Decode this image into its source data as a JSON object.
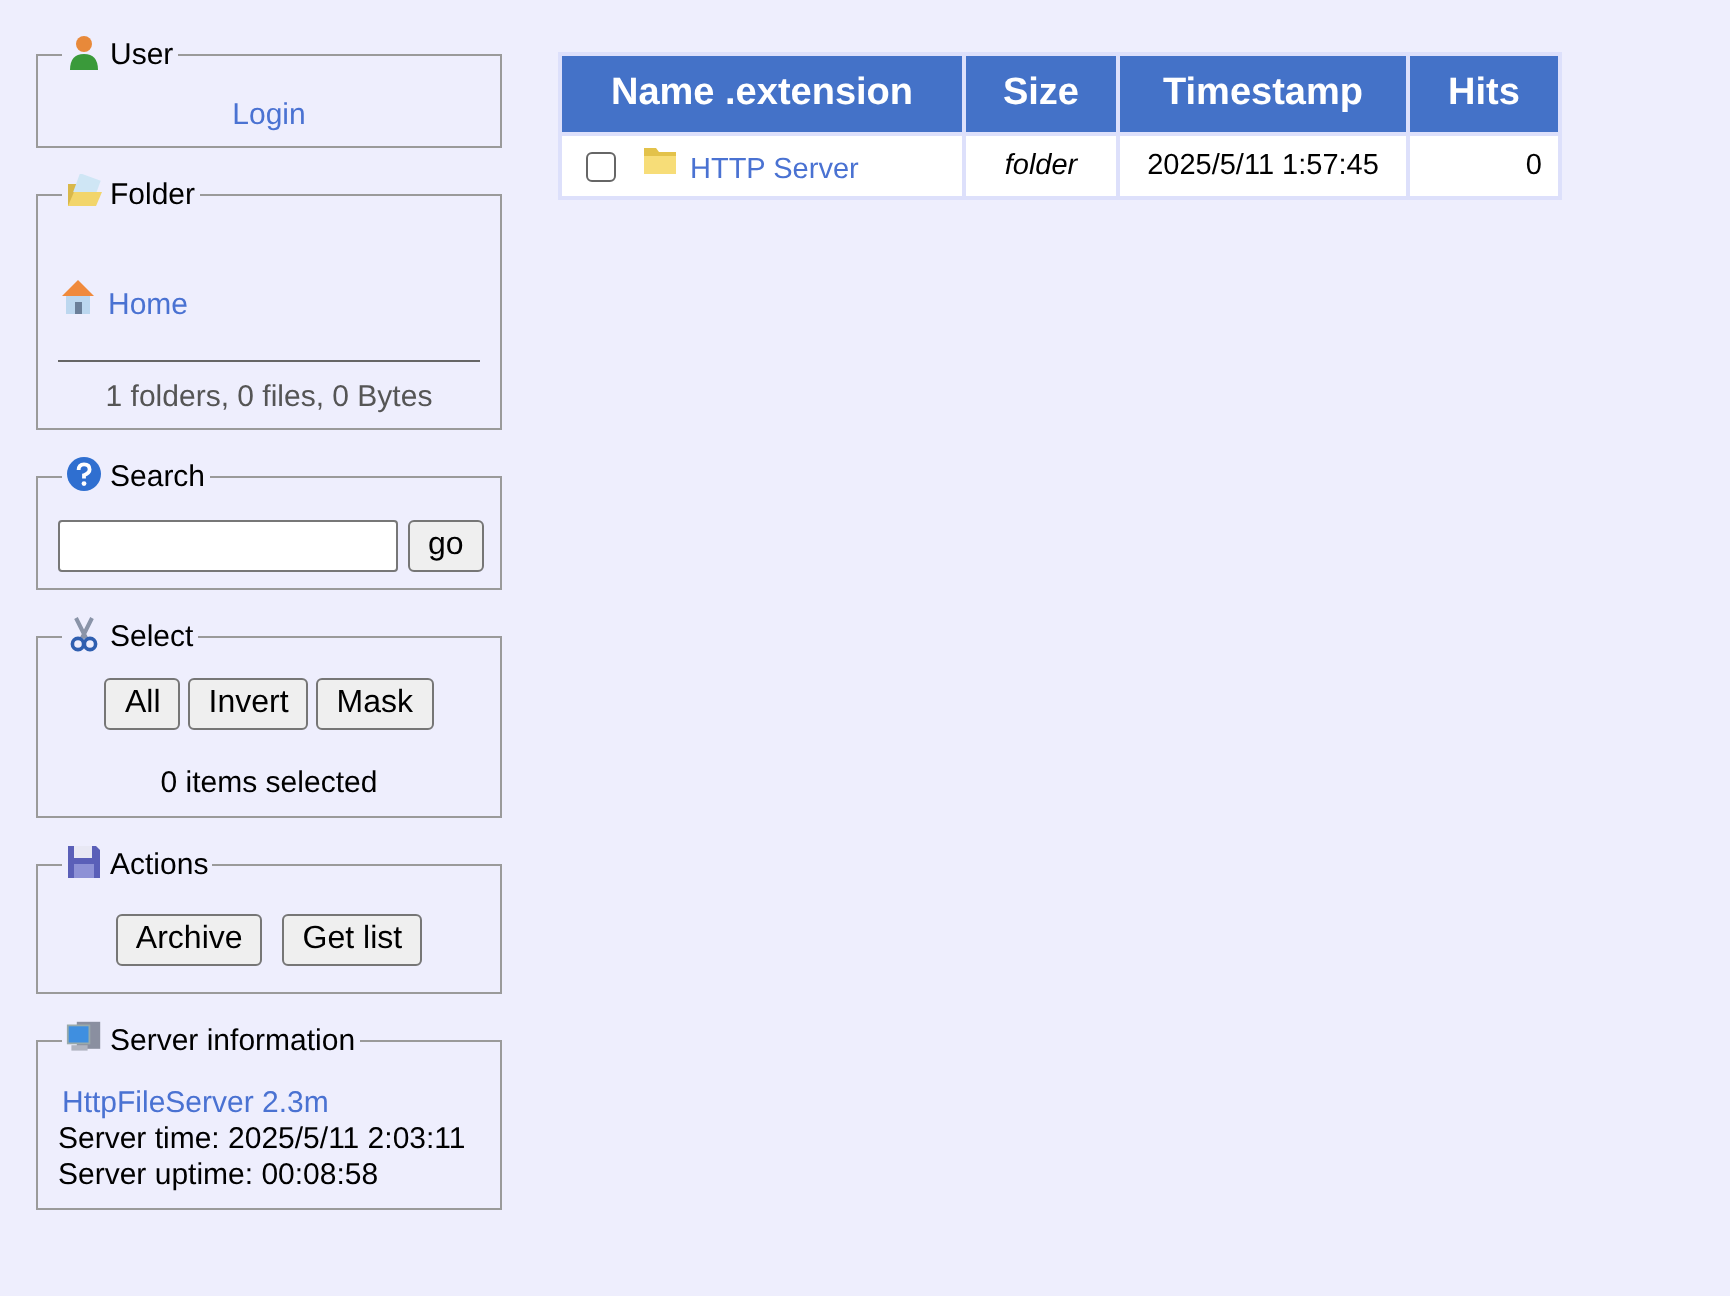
{
  "sidebar": {
    "user": {
      "title": "User",
      "login": "Login"
    },
    "folder": {
      "title": "Folder",
      "home": "Home",
      "summary": "1 folders, 0 files, 0 Bytes"
    },
    "search": {
      "title": "Search",
      "button": "go"
    },
    "select": {
      "title": "Select",
      "buttons": [
        "All",
        "Invert",
        "Mask"
      ],
      "status": "0 items selected"
    },
    "actions": {
      "title": "Actions",
      "buttons": [
        "Archive",
        "Get list"
      ]
    },
    "server_info": {
      "title": "Server information",
      "version": "HttpFileServer 2.3m",
      "lines": [
        "Server time: 2025/5/11 2:03:11",
        "Server uptime: 00:08:58"
      ]
    }
  },
  "table": {
    "columns": [
      "Name .extension",
      "Size",
      "Timestamp",
      "Hits"
    ],
    "rows": [
      {
        "kind": "folder",
        "checked": false,
        "name": "HTTP Server",
        "size": "folder",
        "timestamp": "2025/5/11 1:57:45",
        "hits": "0"
      }
    ]
  }
}
